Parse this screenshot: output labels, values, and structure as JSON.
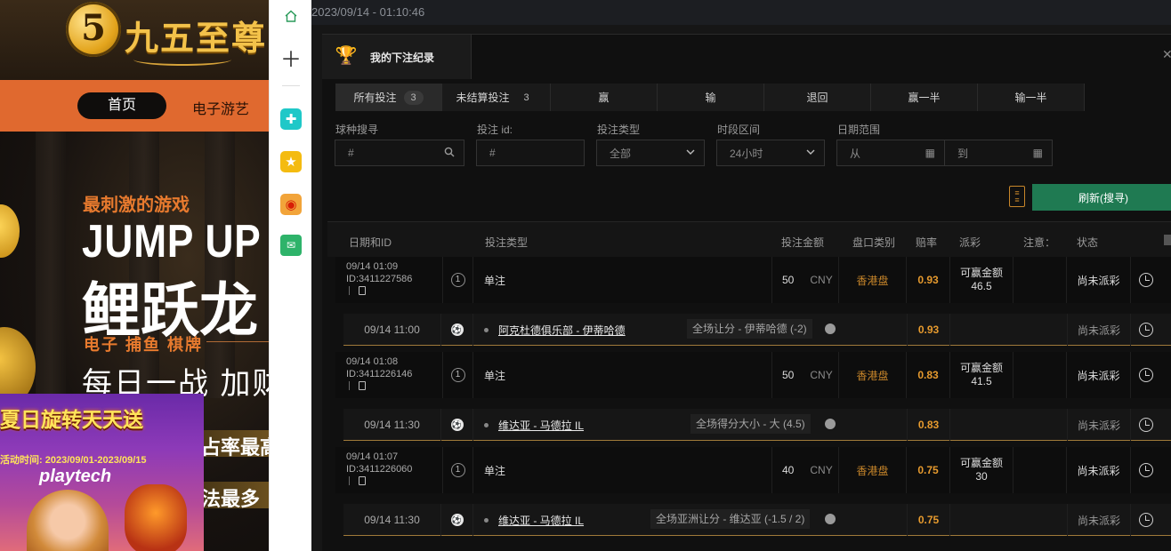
{
  "site": {
    "logo_badge": "5",
    "logo_text": "九五至尊",
    "nav": {
      "home": "首页",
      "games": "电子游艺"
    },
    "hero": {
      "tagline": "最刺激的游戏",
      "title_en": "JUMP UP",
      "title_cn": "鲤跃龙",
      "categories": "电子 捕鱼 棋牌",
      "daily": "每日一战 加财",
      "line1": "占率最高",
      "line2": "法最多"
    },
    "promo": {
      "title": "夏日旋转天天送",
      "date": "活动时间: 2023/09/01-2023/09/15",
      "brand": "playtech"
    }
  },
  "rail": {
    "icons": [
      "home-icon",
      "add-icon",
      "plus-app-icon",
      "star-icon",
      "weibo-icon",
      "mail-icon"
    ]
  },
  "app": {
    "timestamp": "2023/09/14 - 01:10:46",
    "panel_title": "我的下注纪录",
    "tabs": [
      {
        "label": "所有投注",
        "count": "3"
      },
      {
        "label": "未结算投注",
        "count": "3"
      },
      {
        "label": "赢"
      },
      {
        "label": "输"
      },
      {
        "label": "退回"
      },
      {
        "label": "赢一半"
      },
      {
        "label": "输一半"
      }
    ],
    "filters": {
      "sport_label": "球种搜寻",
      "sport_placeholder": "#",
      "bet_id_label": "投注 id:",
      "bet_id_placeholder": "#",
      "bet_type_label": "投注类型",
      "bet_type_value": "全部",
      "period_label": "时段区间",
      "period_value": "24小时",
      "date_label": "日期范围",
      "date_from": "从",
      "date_to": "到"
    },
    "refresh_label": "刷新(搜寻)",
    "headers": {
      "date_id": "日期和ID",
      "bet_type": "投注类型",
      "stake": "投注金额",
      "market": "盘口类别",
      "odds": "赔率",
      "payout": "派彩",
      "note": "注意：",
      "status": "状态"
    },
    "bets": [
      {
        "date": "09/14 01:09",
        "id": "ID:3411227586",
        "num": "1",
        "type": "单注",
        "stake": "50",
        "currency": "CNY",
        "market": "香港盘",
        "odds": "0.93",
        "payout_label": "可赢金额",
        "payout": "46.5",
        "status": "尚未派彩",
        "selection": {
          "date": "09/14 11:00",
          "match": "阿克杜德俱乐部 - 伊蒂哈德",
          "pick": "全场让分 - 伊蒂哈德 (-2)",
          "odds": "0.93",
          "status": "尚未派彩"
        }
      },
      {
        "date": "09/14 01:08",
        "id": "ID:3411226146",
        "num": "1",
        "type": "单注",
        "stake": "50",
        "currency": "CNY",
        "market": "香港盘",
        "odds": "0.83",
        "payout_label": "可赢金额",
        "payout": "41.5",
        "status": "尚未派彩",
        "selection": {
          "date": "09/14 11:30",
          "match": "维达亚 - 马德拉 IL",
          "pick": "全场得分大小 - 大 (4.5)",
          "odds": "0.83",
          "status": "尚未派彩"
        }
      },
      {
        "date": "09/14 01:07",
        "id": "ID:3411226060",
        "num": "1",
        "type": "单注",
        "stake": "40",
        "currency": "CNY",
        "market": "香港盘",
        "odds": "0.75",
        "payout_label": "可赢金额",
        "payout": "30",
        "status": "尚未派彩",
        "selection": {
          "date": "09/14 11:30",
          "match": "维达亚 - 马德拉 IL",
          "pick": "全场亚洲让分 - 维达亚 (-1.5 / 2)",
          "odds": "0.75",
          "status": "尚未派彩"
        }
      }
    ]
  },
  "colors": {
    "accent_orange": "#e0692f",
    "odds": "#e69a2e",
    "refresh_green": "#1f7a52"
  }
}
